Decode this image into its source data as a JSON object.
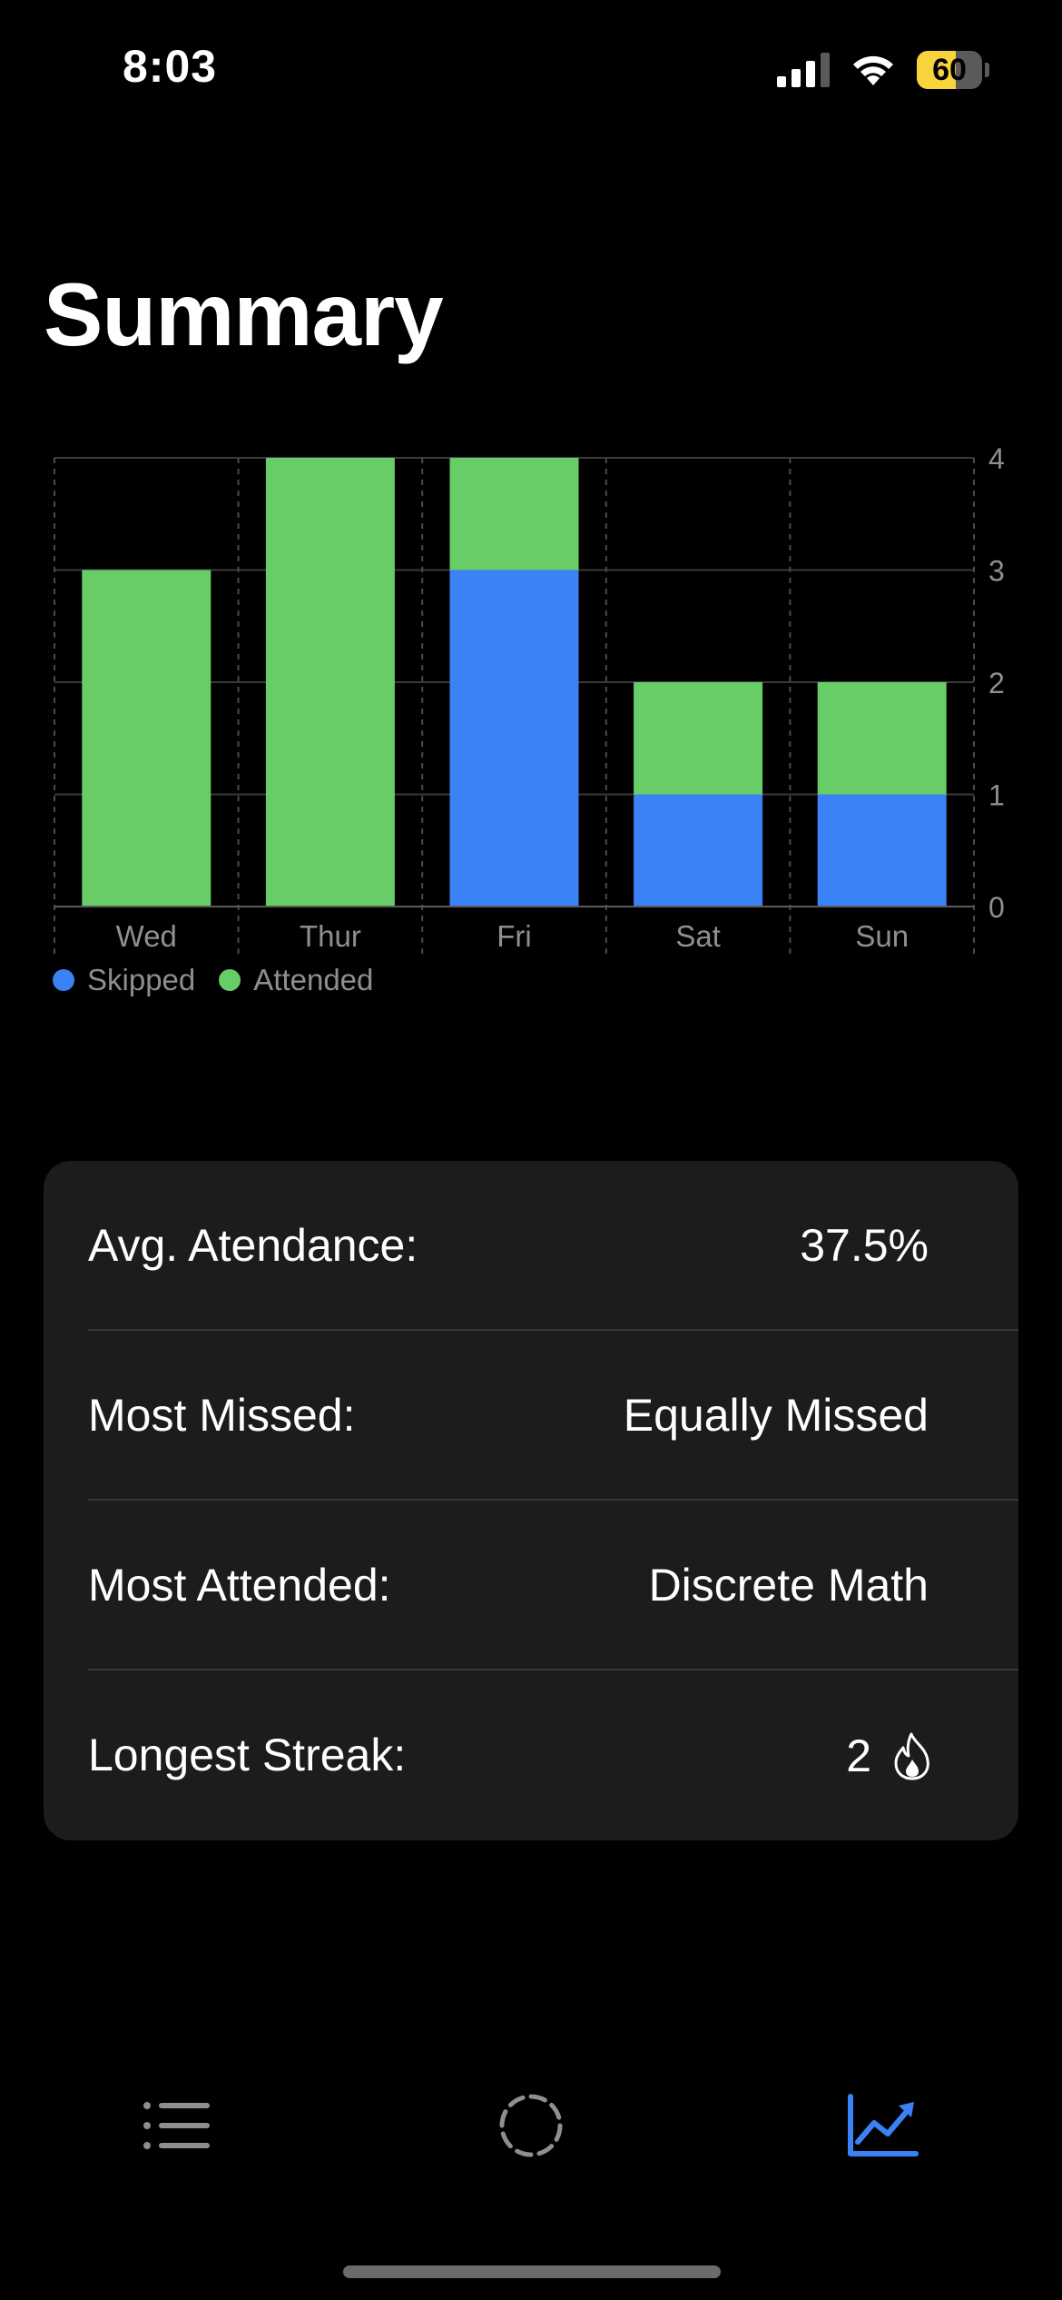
{
  "status_bar": {
    "time": "8:03",
    "battery_level": "60",
    "battery_fraction": 0.6,
    "icons": [
      "cellular-signal-icon",
      "wifi-icon",
      "battery-icon"
    ]
  },
  "page": {
    "title": "Summary"
  },
  "chart_data": {
    "type": "bar",
    "stacked": true,
    "categories": [
      "Wed",
      "Thur",
      "Fri",
      "Sat",
      "Sun"
    ],
    "series": [
      {
        "name": "Skipped",
        "values": [
          0,
          0,
          3,
          1,
          1
        ],
        "color": "#3b82f6"
      },
      {
        "name": "Attended",
        "values": [
          3,
          4,
          1,
          1,
          1
        ],
        "color": "#68cd67"
      }
    ],
    "yticks": [
      0,
      1,
      2,
      3,
      4
    ],
    "ylim": [
      0,
      4
    ],
    "grid": true,
    "y_axis_position": "right",
    "legend_position": "bottom-left"
  },
  "stats": {
    "avg_attendance": {
      "label": "Avg. Atendance:",
      "value": "37.5%"
    },
    "most_missed": {
      "label": "Most Missed:",
      "value": "Equally Missed"
    },
    "most_attended": {
      "label": "Most Attended:",
      "value": "Discrete Math"
    },
    "longest_streak": {
      "label": "Longest Streak:",
      "value": "2",
      "icon": "flame-icon"
    }
  },
  "tab_bar": {
    "tabs": [
      {
        "icon": "list-icon",
        "active": false
      },
      {
        "icon": "dashed-circle-icon",
        "active": false
      },
      {
        "icon": "chart-trend-icon",
        "active": true
      }
    ],
    "active_color": "#3b82f6",
    "inactive_color": "#8e8e93"
  }
}
